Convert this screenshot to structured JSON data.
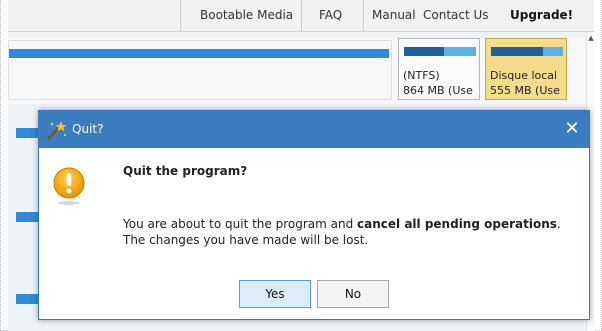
{
  "menu": {
    "bootable_media": "Bootable Media",
    "faq": "FAQ",
    "manual": "Manual",
    "contact_us": "Contact Us",
    "upgrade": "Upgrade!"
  },
  "partitions": [
    {
      "line1": "(NTFS)",
      "line2": "864 MB (Use",
      "used_fraction": 0.55,
      "selected": false
    },
    {
      "line1": "Disque local",
      "line2": "555 MB (Use",
      "used_fraction": 0.72,
      "selected": true
    }
  ],
  "dialog": {
    "title": "Quit?",
    "close_symbol": "✕",
    "question": "Quit the program?",
    "message_part1": "You are about to quit the program and ",
    "message_bold": "cancel all pending operations",
    "message_part2": ".",
    "message_line2": "The changes you have made will be lost.",
    "yes_label": "Yes",
    "no_label": "No"
  },
  "colors": {
    "accent": "#3a7ec0",
    "partition_bar": "#2f8bd7",
    "selected_partition": "#f4dc8a",
    "warning": "#f3a400"
  },
  "icons": {
    "title_icon": "wizard-icon",
    "warning_icon": "warning-icon",
    "close_icon": "close-icon"
  }
}
